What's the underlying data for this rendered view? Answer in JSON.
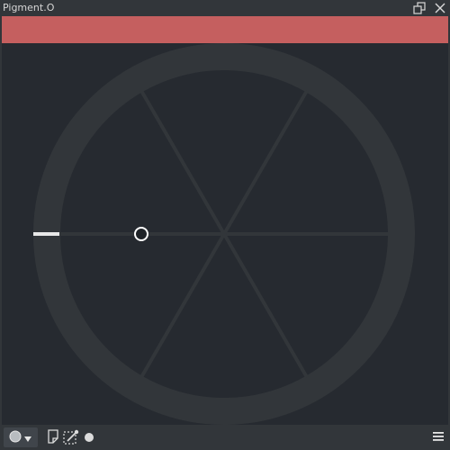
{
  "window": {
    "title": "Pigment.O"
  },
  "color_bar": {
    "color": "#c55f5f"
  },
  "wheel": {
    "background": "#262a30",
    "ring_color": "#32363a",
    "spoke_color": "#32363a",
    "marker_color": "#e8e8e8",
    "cursor_border": "#ffffff",
    "cursor_inner": "#1e2227"
  },
  "icons": {
    "float": "float-window-icon",
    "close": "close-icon",
    "mode": "color-circle-icon",
    "dropdown": "dropdown-arrow-icon",
    "note": "note-icon",
    "pick": "eyedropper-selection-icon",
    "dot": "dot-icon",
    "menu": "hamburger-menu-icon"
  }
}
